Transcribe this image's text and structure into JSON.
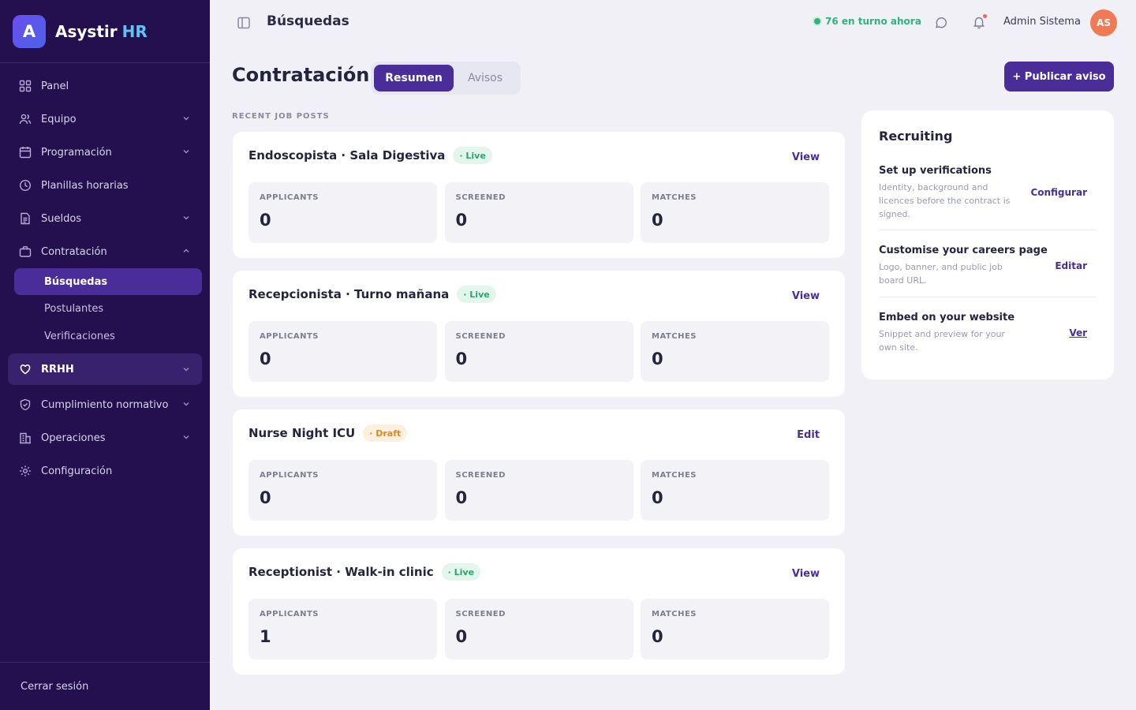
{
  "brand": {
    "logo_letter": "A",
    "name": "Asystir",
    "accent": "HR"
  },
  "sidebar": {
    "items": [
      {
        "label": "Panel",
        "icon": "grid-icon"
      },
      {
        "label": "Equipo",
        "icon": "users-icon"
      },
      {
        "label": "Programación",
        "icon": "calendar-icon"
      },
      {
        "label": "Planillas horarias",
        "icon": "clock-icon"
      },
      {
        "label": "Sueldos",
        "icon": "document-icon"
      },
      {
        "label": "Contratación",
        "icon": "briefcase-icon"
      },
      {
        "label": "RRHH",
        "icon": "heart-icon"
      },
      {
        "label": "Cumplimiento normativo",
        "icon": "shield-icon"
      },
      {
        "label": "Operaciones",
        "icon": "building-icon"
      },
      {
        "label": "Configuración",
        "icon": "gear-icon"
      }
    ],
    "subitems": [
      {
        "label": "Búsquedas",
        "active": true
      },
      {
        "label": "Postulantes",
        "active": false
      },
      {
        "label": "Verificaciones",
        "active": false
      }
    ],
    "logout": "Cerrar sesión"
  },
  "header": {
    "title": "Búsquedas",
    "on_shift": "76 en turno ahora",
    "user_name": "Admin Sistema",
    "avatar_initials": "AS"
  },
  "main": {
    "title": "Contratación",
    "tabs": [
      {
        "label": "Resumen",
        "active": true
      },
      {
        "label": "Avisos",
        "active": false
      }
    ],
    "publish_label": "+ Publicar aviso",
    "section_label": "RECENT JOB POSTS",
    "stat_labels": {
      "applicants": "APPLICANTS",
      "screened": "SCREENED",
      "matches": "MATCHES"
    },
    "jobs": [
      {
        "title": "Endoscopista · Sala Digestiva",
        "status": "· Live",
        "action": "View",
        "applicants": "0",
        "screened": "0",
        "matches": "0"
      },
      {
        "title": "Recepcionista · Turno mañana",
        "status": "· Live",
        "action": "View",
        "applicants": "0",
        "screened": "0",
        "matches": "0"
      },
      {
        "title": "Nurse Night ICU",
        "status": "· Draft",
        "action": "Edit",
        "applicants": "0",
        "screened": "0",
        "matches": "0"
      },
      {
        "title": "Receptionist · Walk-in clinic",
        "status": "· Live",
        "action": "View",
        "applicants": "1",
        "screened": "0",
        "matches": "0"
      }
    ]
  },
  "panel": {
    "title": "Recruiting",
    "items": [
      {
        "title": "Set up verifications",
        "desc": "Identity, background and licences before the contract is signed.",
        "action": "Configurar"
      },
      {
        "title": "Customise your careers page",
        "desc": "Logo, banner, and public job board URL.",
        "action": "Editar"
      },
      {
        "title": "Embed on your website",
        "desc": "Snippet and preview for your own site.",
        "action": "Ver"
      }
    ]
  },
  "colors": {
    "sidebar_bg": "#24104f",
    "accent": "#4a2d99",
    "live_green": "#2aa56f",
    "draft_orange": "#d98a22",
    "avatar": "#ef7a55"
  }
}
